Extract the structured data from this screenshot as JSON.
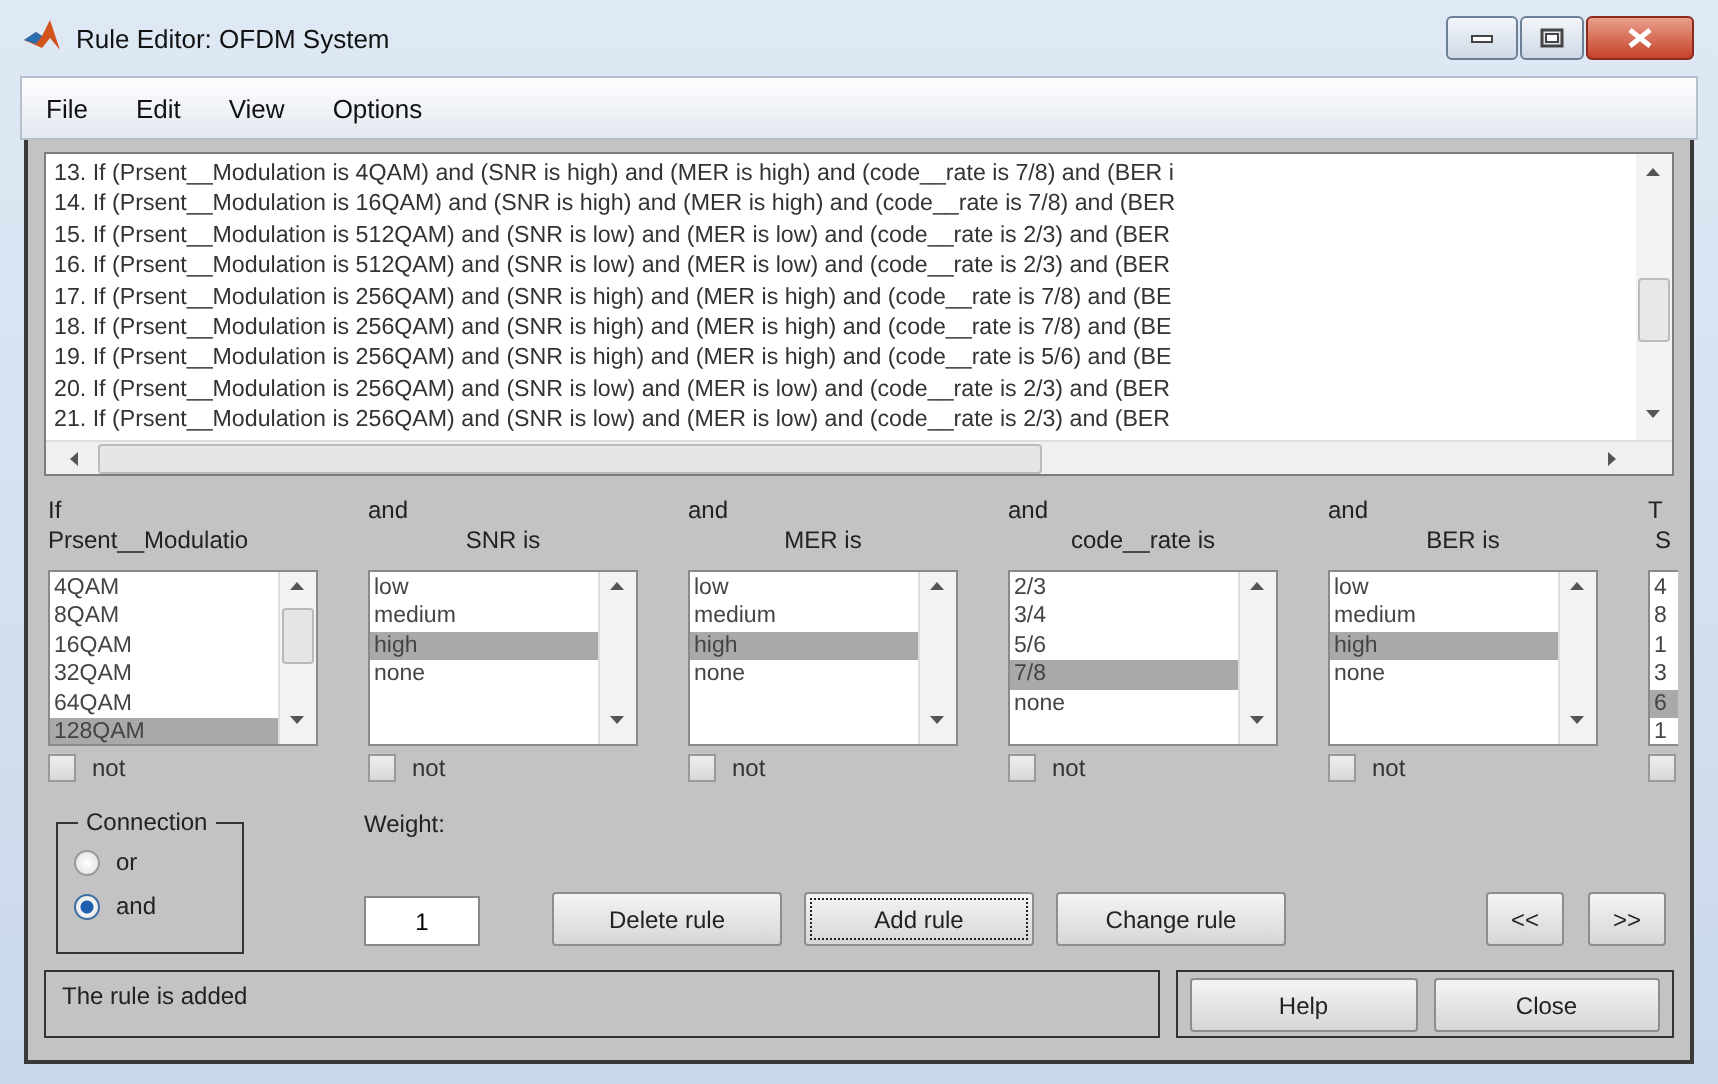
{
  "window": {
    "title": "Rule Editor: OFDM System"
  },
  "menu": [
    "File",
    "Edit",
    "View",
    "Options"
  ],
  "rules": [
    "13. If (Prsent__Modulation is 4QAM) and (SNR is high) and (MER is high) and (code__rate is 7/8) and (BER i",
    "14. If (Prsent__Modulation is 16QAM) and (SNR is high) and (MER is high) and (code__rate is 7/8) and (BER",
    "15. If (Prsent__Modulation is 512QAM) and (SNR is low) and (MER is low) and (code__rate is 2/3) and (BER",
    "16. If (Prsent__Modulation is 512QAM) and (SNR is low) and (MER is low) and (code__rate is 2/3) and (BER",
    "17. If (Prsent__Modulation is 256QAM) and (SNR is high) and (MER is high) and (code__rate is 7/8) and (BE",
    "18. If (Prsent__Modulation is 256QAM) and (SNR is high) and (MER is high) and (code__rate is 7/8) and (BE",
    "19. If (Prsent__Modulation is 256QAM) and (SNR is high) and (MER is high) and (code__rate is 5/6) and (BE",
    "20. If (Prsent__Modulation is 256QAM) and (SNR is low) and (MER is low) and (code__rate is 2/3) and (BER",
    "21. If (Prsent__Modulation is 256QAM) and (SNR is low) and (MER is low) and (code__rate is 2/3) and (BER"
  ],
  "columns": [
    {
      "connective": "If",
      "label": "Prsent__Modulatio",
      "negated": false,
      "items": [
        {
          "text": "4QAM",
          "selected": false
        },
        {
          "text": "8QAM",
          "selected": false
        },
        {
          "text": "16QAM",
          "selected": false
        },
        {
          "text": "32QAM",
          "selected": false
        },
        {
          "text": "64QAM",
          "selected": false
        },
        {
          "text": "128QAM",
          "selected": true
        }
      ]
    },
    {
      "connective": "and",
      "label": "SNR is",
      "negated": false,
      "items": [
        {
          "text": "low",
          "selected": false
        },
        {
          "text": "medium",
          "selected": false
        },
        {
          "text": "high",
          "selected": true
        },
        {
          "text": "none",
          "selected": false
        }
      ]
    },
    {
      "connective": "and",
      "label": "MER is",
      "negated": false,
      "items": [
        {
          "text": "low",
          "selected": false
        },
        {
          "text": "medium",
          "selected": false
        },
        {
          "text": "high",
          "selected": true
        },
        {
          "text": "none",
          "selected": false
        }
      ]
    },
    {
      "connective": "and",
      "label": "code__rate is",
      "negated": false,
      "items": [
        {
          "text": "2/3",
          "selected": false
        },
        {
          "text": "3/4",
          "selected": false
        },
        {
          "text": "5/6",
          "selected": false
        },
        {
          "text": "7/8",
          "selected": true
        },
        {
          "text": "none",
          "selected": false
        }
      ]
    },
    {
      "connective": "and",
      "label": "BER is",
      "negated": false,
      "items": [
        {
          "text": "low",
          "selected": false
        },
        {
          "text": "medium",
          "selected": false
        },
        {
          "text": "high",
          "selected": true
        },
        {
          "text": "none",
          "selected": false
        }
      ]
    },
    {
      "connective": "T",
      "label": "S",
      "negated": false,
      "items": [
        {
          "text": "4",
          "selected": false
        },
        {
          "text": "8",
          "selected": false
        },
        {
          "text": "1",
          "selected": false
        },
        {
          "text": "3",
          "selected": false
        },
        {
          "text": "6",
          "selected": true
        },
        {
          "text": "1",
          "selected": false
        }
      ]
    }
  ],
  "not_labels": [
    "not",
    "not",
    "not",
    "not",
    "not"
  ],
  "connection": {
    "title": "Connection",
    "options": [
      {
        "label": "or",
        "selected": false
      },
      {
        "label": "and",
        "selected": true
      }
    ]
  },
  "weight": {
    "label": "Weight:",
    "value": "1"
  },
  "buttons": [
    {
      "label": "Delete rule",
      "focused": false
    },
    {
      "label": "Add rule",
      "focused": true
    },
    {
      "label": "Change rule",
      "focused": false
    }
  ],
  "nav_buttons": [
    "<<",
    ">>"
  ],
  "status": "The rule is added",
  "footer_buttons": [
    "Help",
    "Close"
  ]
}
